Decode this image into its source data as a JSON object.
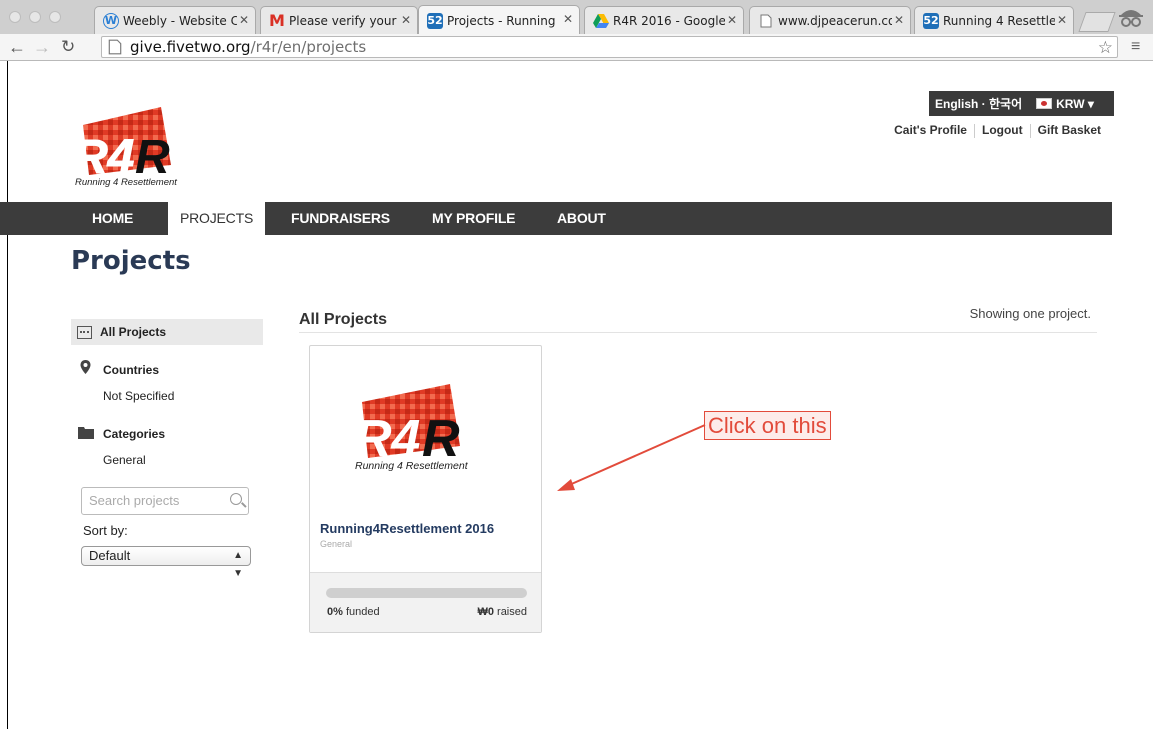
{
  "browser": {
    "tabs": [
      {
        "label": "Weebly - Website C",
        "favicon": "weebly-icon",
        "active": false
      },
      {
        "label": "Please verify your e",
        "favicon": "gmail-icon",
        "active": false
      },
      {
        "label": "Projects - Running",
        "favicon": "fivetwo-icon",
        "active": true
      },
      {
        "label": "R4R 2016 - Google",
        "favicon": "google-drive-icon",
        "active": false
      },
      {
        "label": "www.djpeacerun.co",
        "favicon": "page-icon",
        "active": false
      },
      {
        "label": "Running 4 Resettle",
        "favicon": "fivetwo-icon",
        "active": false
      }
    ],
    "url_domain": "give.fivetwo.org",
    "url_path": "/r4r/en/projects"
  },
  "header": {
    "language": "English · 한국어",
    "currency": "KRW ▾",
    "user_links": [
      "Cait's Profile",
      "Logout",
      "Gift Basket"
    ]
  },
  "brand": {
    "logo_text": "R4R",
    "tagline": "Running 4 Resettlement",
    "logo_color": "#e03a25"
  },
  "nav": {
    "items": [
      "HOME",
      "PROJECTS",
      "FUNDRAISERS",
      "MY PROFILE",
      "ABOUT"
    ],
    "active": "PROJECTS"
  },
  "page": {
    "title": "Projects"
  },
  "sidebar": {
    "all_projects": "All Projects",
    "countries_label": "Countries",
    "countries_value": "Not Specified",
    "categories_label": "Categories",
    "categories_value": "General",
    "search_placeholder": "Search projects",
    "sort_label": "Sort by:",
    "sort_value": "Default"
  },
  "main": {
    "section_title": "All Projects",
    "showing": "Showing one project."
  },
  "project": {
    "title": "Running4Resettlement 2016",
    "category": "General",
    "funded_pct": "0%",
    "funded_label": "funded",
    "funded_fraction": 0,
    "raised": "₩0",
    "raised_label": "raised"
  },
  "annotation": {
    "callout": "Click on this",
    "color": "#e24b3b"
  }
}
